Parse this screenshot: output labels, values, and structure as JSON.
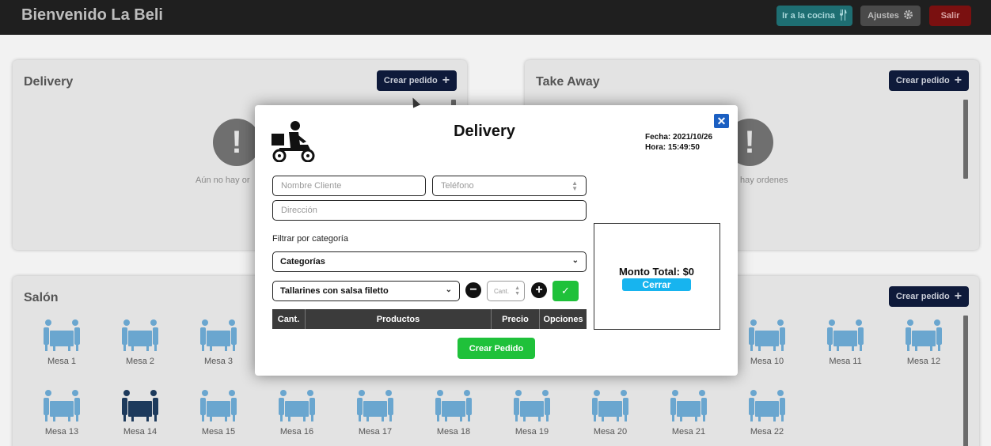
{
  "header": {
    "title": "Bienvenido La Beli",
    "kitchen_label": "Ir a la cocina",
    "settings_label": "Ajustes",
    "exit_label": "Salir"
  },
  "delivery_panel": {
    "title": "Delivery",
    "create_label": "Crear pedido",
    "empty_text": "Aún no hay or"
  },
  "takeaway_panel": {
    "title": "Take Away",
    "create_label": "Crear pedido",
    "empty_text": "hay ordenes"
  },
  "salon_panel": {
    "title": "Salón",
    "create_label": "Crear pedido",
    "tables": [
      {
        "label": "Mesa 1",
        "occupied": false
      },
      {
        "label": "Mesa 2",
        "occupied": false
      },
      {
        "label": "Mesa 3",
        "occupied": false
      },
      {
        "label": "Mesa 10",
        "occupied": false
      },
      {
        "label": "Mesa 11",
        "occupied": false
      },
      {
        "label": "Mesa 12",
        "occupied": false
      },
      {
        "label": "Mesa 13",
        "occupied": false
      },
      {
        "label": "Mesa 14",
        "occupied": true
      },
      {
        "label": "Mesa 15",
        "occupied": false
      },
      {
        "label": "Mesa 16",
        "occupied": false
      },
      {
        "label": "Mesa 17",
        "occupied": false
      },
      {
        "label": "Mesa 18",
        "occupied": false
      },
      {
        "label": "Mesa 19",
        "occupied": false
      },
      {
        "label": "Mesa 20",
        "occupied": false
      },
      {
        "label": "Mesa 21",
        "occupied": false
      },
      {
        "label": "Mesa 22",
        "occupied": false
      }
    ]
  },
  "modal": {
    "title": "Delivery",
    "date_line": "Fecha: 2021/10/26",
    "time_line": "Hora: 15:49:50",
    "close_icon": "close-icon",
    "name_placeholder": "Nombre Cliente",
    "phone_placeholder": "Teléfono",
    "address_placeholder": "Dirección",
    "filter_label": "Filtrar por categoría",
    "category_value": "Categorías",
    "product_value": "Tallarines con salsa filetto",
    "qty_placeholder": "Cant.",
    "table_headers": [
      "Cant.",
      "Productos",
      "Precio",
      "Opciones"
    ],
    "total_label": "Monto Total: $0",
    "close_button_label": "Cerrar",
    "create_order_label": "Crear Pedido"
  },
  "colors": {
    "accent_green": "#1fc13a",
    "accent_blue": "#17b4ef",
    "navy": "#0e1a3a",
    "table_blue": "#6aa6cf",
    "table_occupied": "#1d3a5c"
  }
}
